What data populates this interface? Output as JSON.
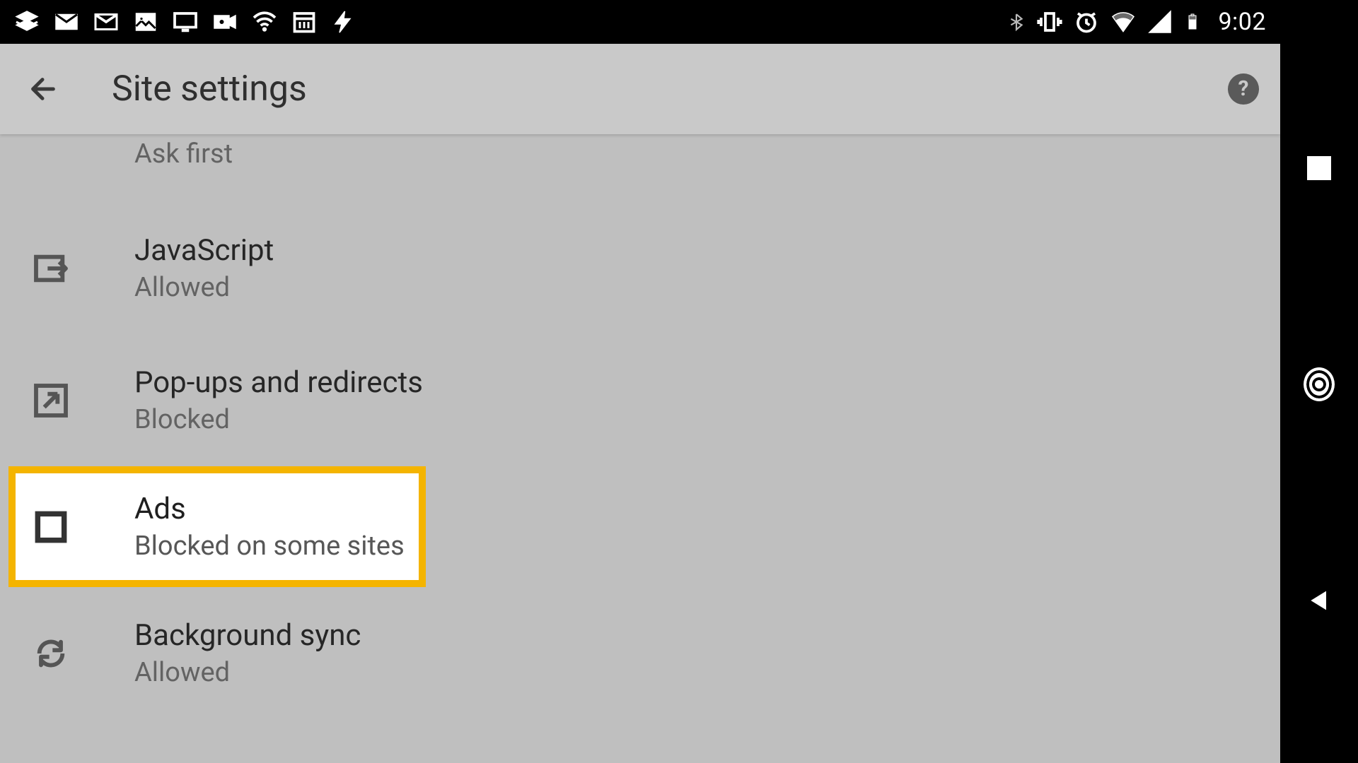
{
  "statusbar": {
    "clock": "9:02"
  },
  "appbar": {
    "title": "Site settings"
  },
  "rows": {
    "peek": {
      "subtitle": "Ask first"
    },
    "javascript": {
      "title": "JavaScript",
      "subtitle": "Allowed"
    },
    "popups": {
      "title": "Pop-ups and redirects",
      "subtitle": "Blocked"
    },
    "ads": {
      "title": "Ads",
      "subtitle": "Blocked on some sites"
    },
    "bgsync": {
      "title": "Background sync",
      "subtitle": "Allowed"
    }
  }
}
